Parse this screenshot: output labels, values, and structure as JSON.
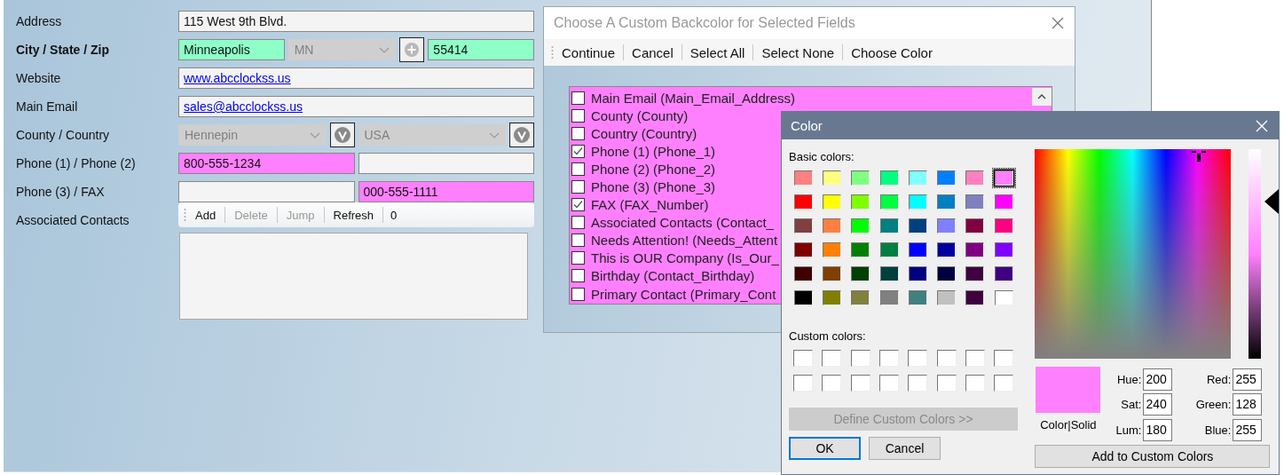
{
  "form": {
    "rows": [
      {
        "label": "Address",
        "bold": false,
        "controls": [
          {
            "kind": "text",
            "value": "115 West 9th Blvd."
          }
        ]
      },
      {
        "label": "City / State / Zip",
        "bold": true,
        "controls": [
          {
            "kind": "text",
            "value": "Minneapolis",
            "color": "#8fffc8"
          },
          {
            "kind": "combo",
            "value": "MN",
            "disabled": true
          },
          {
            "kind": "plus-button"
          },
          {
            "kind": "text",
            "value": "55414",
            "color": "#8fffc8"
          }
        ]
      },
      {
        "label": "Website",
        "bold": false,
        "controls": [
          {
            "kind": "link",
            "value": "www.abcclockss.us"
          }
        ]
      },
      {
        "label": "Main Email",
        "bold": false,
        "controls": [
          {
            "kind": "link",
            "value": "sales@abcclockss.us"
          }
        ]
      },
      {
        "label": "County / Country",
        "bold": false,
        "controls": [
          {
            "kind": "combo",
            "value": "Hennepin",
            "disabled": true
          },
          {
            "kind": "check-button"
          },
          {
            "kind": "combo",
            "value": "USA",
            "disabled": true
          },
          {
            "kind": "check-button"
          }
        ]
      },
      {
        "label": "Phone (1) / Phone (2)",
        "bold": false,
        "controls": [
          {
            "kind": "text",
            "value": "800-555-1234",
            "color": "#ff80ff"
          },
          {
            "kind": "text"
          }
        ]
      },
      {
        "label": "Phone (3) / FAX",
        "bold": false,
        "controls": [
          {
            "kind": "text"
          },
          {
            "kind": "text",
            "value": "000-555-1111",
            "color": "#ff80ff"
          }
        ]
      }
    ],
    "contacts": {
      "label": "Associated Contacts",
      "toolbar": [
        {
          "label": "Add",
          "disabled": false
        },
        {
          "label": "Delete",
          "disabled": true
        },
        {
          "label": "Jump",
          "disabled": true
        },
        {
          "label": "Refresh",
          "disabled": false
        }
      ],
      "count": "0"
    }
  },
  "backcolor_dialog": {
    "title": "Choose A Custom Backcolor for Selected Fields",
    "toolbar": [
      "Continue",
      "Cancel",
      "Select All",
      "Select None",
      "Choose Color"
    ],
    "fields": [
      {
        "label": "Main Email (Main_Email_Address)",
        "checked": false
      },
      {
        "label": "County (County)",
        "checked": false
      },
      {
        "label": "Country (Country)",
        "checked": false
      },
      {
        "label": "Phone (1) (Phone_1)",
        "checked": true
      },
      {
        "label": "Phone (2) (Phone_2)",
        "checked": false
      },
      {
        "label": "Phone (3) (Phone_3)",
        "checked": false
      },
      {
        "label": "FAX (FAX_Number)",
        "checked": true
      },
      {
        "label": "Associated Contacts (Contact_",
        "checked": false
      },
      {
        "label": "Needs Attention! (Needs_Attent",
        "checked": false
      },
      {
        "label": "This is OUR Company (Is_Our_",
        "checked": false
      },
      {
        "label": "Birthday (Contact_Birthday)",
        "checked": false
      },
      {
        "label": "Primary Contact (Primary_Cont",
        "checked": false
      }
    ]
  },
  "color_dialog": {
    "title": "Color",
    "basic_label": "Basic colors:",
    "basic_colors": [
      {
        "color": "#ff8080",
        "selected": false
      },
      {
        "color": "#ffff80",
        "selected": false
      },
      {
        "color": "#80ff80",
        "selected": false
      },
      {
        "color": "#00ff80",
        "selected": false
      },
      {
        "color": "#80ffff",
        "selected": false
      },
      {
        "color": "#0080ff",
        "selected": false
      },
      {
        "color": "#ff80c0",
        "selected": false
      },
      {
        "color": "#ff80ff",
        "selected": true
      },
      {
        "color": "#ff0000",
        "selected": false
      },
      {
        "color": "#ffff00",
        "selected": false
      },
      {
        "color": "#80ff00",
        "selected": false
      },
      {
        "color": "#00ff40",
        "selected": false
      },
      {
        "color": "#00ffff",
        "selected": false
      },
      {
        "color": "#0080c0",
        "selected": false
      },
      {
        "color": "#8080c0",
        "selected": false
      },
      {
        "color": "#ff00ff",
        "selected": false
      },
      {
        "color": "#804040",
        "selected": false
      },
      {
        "color": "#ff8040",
        "selected": false
      },
      {
        "color": "#00ff00",
        "selected": false
      },
      {
        "color": "#008080",
        "selected": false
      },
      {
        "color": "#004080",
        "selected": false
      },
      {
        "color": "#8080ff",
        "selected": false
      },
      {
        "color": "#800040",
        "selected": false
      },
      {
        "color": "#ff0080",
        "selected": false
      },
      {
        "color": "#800000",
        "selected": false
      },
      {
        "color": "#ff8000",
        "selected": false
      },
      {
        "color": "#008000",
        "selected": false
      },
      {
        "color": "#008040",
        "selected": false
      },
      {
        "color": "#0000ff",
        "selected": false
      },
      {
        "color": "#0000a0",
        "selected": false
      },
      {
        "color": "#800080",
        "selected": false
      },
      {
        "color": "#8000ff",
        "selected": false
      },
      {
        "color": "#400000",
        "selected": false
      },
      {
        "color": "#804000",
        "selected": false
      },
      {
        "color": "#004000",
        "selected": false
      },
      {
        "color": "#004040",
        "selected": false
      },
      {
        "color": "#000080",
        "selected": false
      },
      {
        "color": "#000040",
        "selected": false
      },
      {
        "color": "#400040",
        "selected": false
      },
      {
        "color": "#400080",
        "selected": false
      },
      {
        "color": "#000000",
        "selected": false
      },
      {
        "color": "#808000",
        "selected": false
      },
      {
        "color": "#808040",
        "selected": false
      },
      {
        "color": "#808080",
        "selected": false
      },
      {
        "color": "#408080",
        "selected": false
      },
      {
        "color": "#c0c0c0",
        "selected": false
      },
      {
        "color": "#400040",
        "selected": false
      },
      {
        "color": "#ffffff",
        "selected": false
      }
    ],
    "custom_label": "Custom colors:",
    "define_button": {
      "label": "Define Custom Colors >>",
      "disabled": true
    },
    "ok_button": "OK",
    "cancel_button": "Cancel",
    "lum_slider": {
      "level": 0.75
    },
    "preview_label": "Color|Solid",
    "values": [
      {
        "label": "Hue:",
        "value": "200"
      },
      {
        "label": "Sat:",
        "value": "240"
      },
      {
        "label": "Lum:",
        "value": "180"
      },
      {
        "label": "Red:",
        "value": "255"
      },
      {
        "label": "Green:",
        "value": "128"
      },
      {
        "label": "Blue:",
        "value": "255"
      }
    ],
    "add_button": "Add to Custom Colors"
  }
}
